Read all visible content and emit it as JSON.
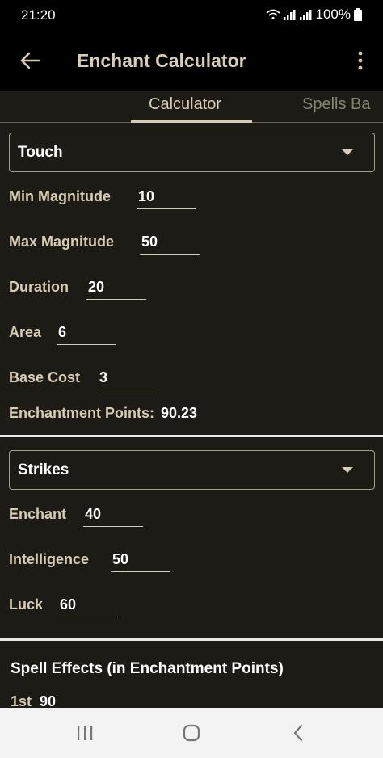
{
  "status_bar": {
    "time": "21:20",
    "battery": "100%"
  },
  "app_bar": {
    "title": "Enchant Calculator"
  },
  "tabs": [
    {
      "label": "Calculator",
      "selected": true
    },
    {
      "label": "Spells Ba",
      "selected": false
    }
  ],
  "range_section": {
    "range_select": "Touch",
    "min_magnitude": {
      "label": "Min Magnitude",
      "value": "10"
    },
    "max_magnitude": {
      "label": "Max Magnitude",
      "value": "50"
    },
    "duration": {
      "label": "Duration",
      "value": "20"
    },
    "area": {
      "label": "Area",
      "value": "6"
    },
    "base_cost": {
      "label": "Base Cost",
      "value": "3"
    },
    "enchantment_points": {
      "label": "Enchantment Points:",
      "value": "90.23"
    }
  },
  "item_section": {
    "item_select": "Strikes",
    "enchant": {
      "label": "Enchant",
      "value": "40"
    },
    "intelligence": {
      "label": "Intelligence",
      "value": "50"
    },
    "luck": {
      "label": "Luck",
      "value": "60"
    }
  },
  "spell_effects": {
    "title": "Spell Effects (in Enchantment Points)",
    "rows": [
      {
        "label": "1st",
        "value": "90"
      }
    ]
  },
  "colors": {
    "accent": "#d8cdb4",
    "surface": "#1c1b16",
    "app_bar": "#000000",
    "nav_bar": "#f3f3f3"
  }
}
